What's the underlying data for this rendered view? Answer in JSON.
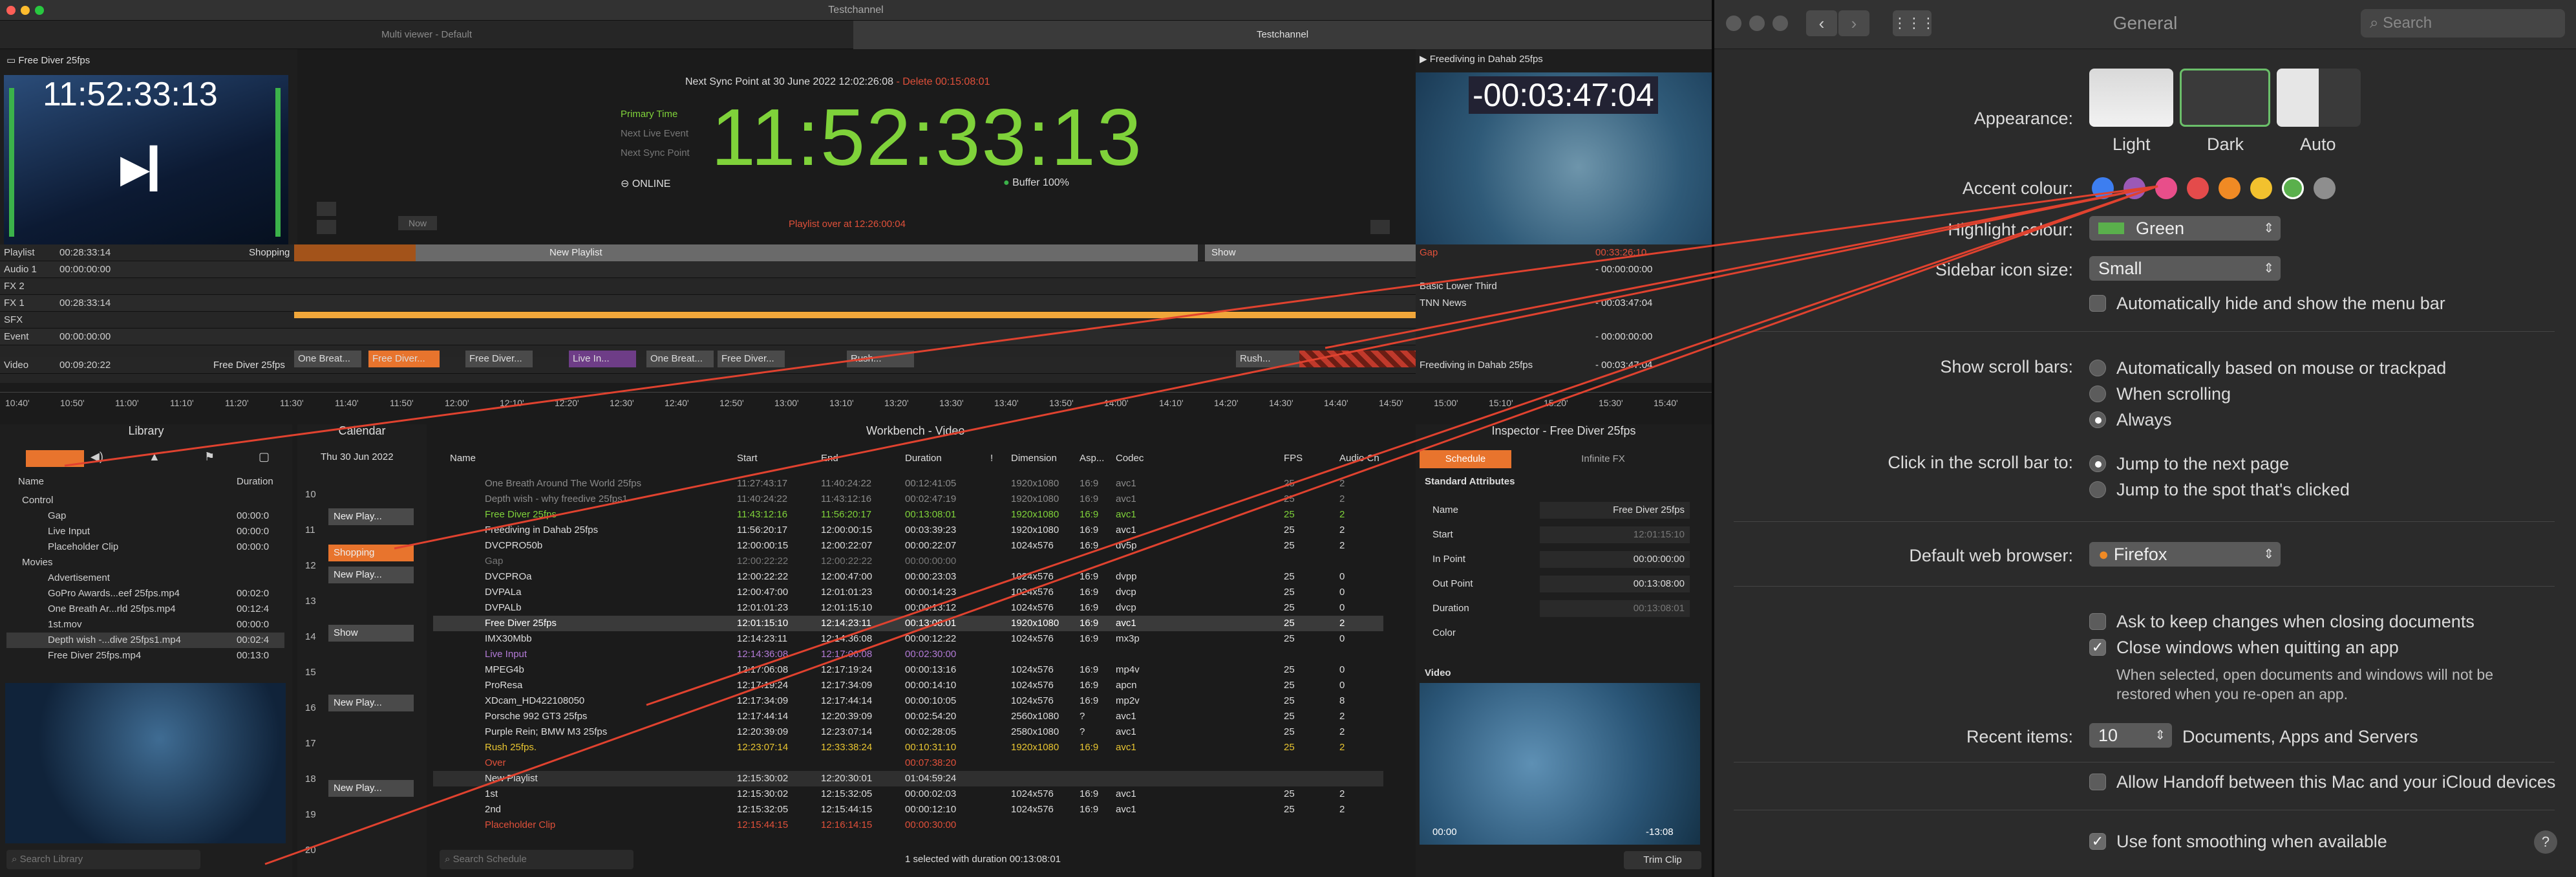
{
  "window": {
    "title": "Testchannel",
    "tabs": [
      "Multi viewer - Default",
      "Testchannel"
    ]
  },
  "preview_left": {
    "title": "Free Diver   25fps",
    "timecode": "11:52:33:13"
  },
  "clock": {
    "sync_line": "Next Sync Point at 30 June 2022 12:02:26:08",
    "sync_delta": "- Delete 00:15:08:01",
    "labels": [
      "Primary Time",
      "Next Live Event",
      "Next Sync Point"
    ],
    "time": "11:52:33:13",
    "status": "ONLINE",
    "buffer_label": "Buffer",
    "buffer_value": "100%",
    "now_button": "Now",
    "playlist_over": "Playlist over at 12:26:00:04"
  },
  "preview_right": {
    "title": "Freediving in Dahab 25fps",
    "timecode": "-00:03:47:04"
  },
  "timeline": {
    "rows": [
      {
        "label": "Playlist",
        "time": "00:28:33:14",
        "extra": "Shopping"
      },
      {
        "label": "Audio 1",
        "time": "00:00:00:00",
        "extra": ""
      },
      {
        "label": "FX 2",
        "time": "",
        "extra": ""
      },
      {
        "label": "FX 1",
        "time": "00:28:33:14",
        "extra": ""
      },
      {
        "label": "SFX",
        "time": "",
        "extra": ""
      },
      {
        "label": "Event",
        "time": "00:00:00:00",
        "extra": ""
      },
      {
        "label": "Video",
        "time": "00:09:20:22",
        "extra": "Free Diver  25fps"
      }
    ],
    "playlist_bars": [
      "New Playlist",
      "Show"
    ],
    "clips": [
      "One Breat...",
      "Free Diver...",
      "Free Diver...",
      "Live In...",
      "One Breat...",
      "Free Diver...",
      "Rush...",
      "Rush..."
    ],
    "right_rows": [
      {
        "label": "Gap",
        "time": "00:33:26:10"
      },
      {
        "label": "",
        "time": "- 00:00:00:00"
      },
      {
        "label": "Basic Lower Third",
        "time": ""
      },
      {
        "label": "TNN News",
        "time": "- 00:03:47:04"
      },
      {
        "label": "",
        "time": ""
      },
      {
        "label": "",
        "time": "- 00:00:00:00"
      },
      {
        "label": "Freediving in Dahab 25fps",
        "time": "- 00:03:47:04"
      }
    ],
    "ruler": [
      "10:40'",
      "10:50'",
      "11:00'",
      "11:10'",
      "11:20'",
      "11:30'",
      "11:40'",
      "11:50'",
      "12:00'",
      "12:10'",
      "12:20'",
      "12:30'",
      "12:40'",
      "12:50'",
      "13:00'",
      "13:10'",
      "13:20'",
      "13:30'",
      "13:40'",
      "13:50'",
      "14:00'",
      "14:10'",
      "14:20'",
      "14:30'",
      "14:40'",
      "14:50'",
      "15:00'",
      "15:10'",
      "15:20'",
      "15:30'",
      "15:40'"
    ]
  },
  "library": {
    "title": "Library",
    "col_name": "Name",
    "col_duration": "Duration",
    "items": [
      {
        "name": "Control",
        "duration": "",
        "indent": 0
      },
      {
        "name": "Gap",
        "duration": "00:00:0",
        "indent": 1
      },
      {
        "name": "Live Input",
        "duration": "00:00:0",
        "indent": 1
      },
      {
        "name": "Placeholder Clip",
        "duration": "00:00:0",
        "indent": 1
      },
      {
        "name": "Movies",
        "duration": "",
        "indent": 0
      },
      {
        "name": "Advertisement",
        "duration": "",
        "indent": 1
      },
      {
        "name": "GoPro Awards...eef 25fps.mp4",
        "duration": "00:02:0",
        "indent": 1
      },
      {
        "name": "One Breath Ar...rld 25fps.mp4",
        "duration": "00:12:4",
        "indent": 1
      },
      {
        "name": "1st.mov",
        "duration": "00:00:0",
        "indent": 1
      },
      {
        "name": "Depth wish -...dive 25fps1.mp4",
        "duration": "00:02:4",
        "indent": 1
      },
      {
        "name": "Free Diver  25fps.mp4",
        "duration": "00:13:0",
        "indent": 1
      }
    ],
    "search_placeholder": "Search Library"
  },
  "calendar": {
    "title": "Calendar",
    "date": "Thu 30 Jun 2022",
    "hours": [
      "10",
      "11",
      "12",
      "13",
      "14",
      "15",
      "16",
      "17",
      "18",
      "19",
      "20"
    ],
    "events": [
      "New Play...",
      "Shopping",
      "New Play...",
      "Show",
      "New Play...",
      "New Play..."
    ]
  },
  "workbench": {
    "title": "Workbench - Video",
    "columns": [
      "Name",
      "Start",
      "End",
      "Duration",
      "!",
      "Dimension",
      "Asp...",
      "Codec",
      "FPS",
      "Audio Ch"
    ],
    "rows": [
      {
        "name": "One Breath Around The World 25fps",
        "start": "11:27:43:17",
        "end": "11:40:24:22",
        "duration": "00:12:41:05",
        "dim": "1920x1080",
        "asp": "16:9",
        "codec": "avc1",
        "fps": "25",
        "audio": "2",
        "color": "#8a8a8a"
      },
      {
        "name": "Depth wish - why freedive 25fps1",
        "start": "11:40:24:22",
        "end": "11:43:12:16",
        "duration": "00:02:47:19",
        "dim": "1920x1080",
        "asp": "16:9",
        "codec": "avc1",
        "fps": "25",
        "audio": "2",
        "color": "#8a8a8a"
      },
      {
        "name": "Free Diver  25fps",
        "start": "11:43:12:16",
        "end": "11:56:20:17",
        "duration": "00:13:08:01",
        "dim": "1920x1080",
        "asp": "16:9",
        "codec": "avc1",
        "fps": "25",
        "audio": "2",
        "color": "#7fd23a"
      },
      {
        "name": "Freediving in Dahab 25fps",
        "start": "11:56:20:17",
        "end": "12:00:00:15",
        "duration": "00:03:39:23",
        "dim": "1920x1080",
        "asp": "16:9",
        "codec": "avc1",
        "fps": "25",
        "audio": "2",
        "color": "#dddddd"
      },
      {
        "name": "DVCPRO50b",
        "start": "12:00:00:15",
        "end": "12:00:22:07",
        "duration": "00:00:22:07",
        "dim": "1024x576",
        "asp": "16:9",
        "codec": "dv5p",
        "fps": "25",
        "audio": "2",
        "color": "#dddddd"
      },
      {
        "name": "Gap",
        "start": "12:00:22:22",
        "end": "12:00:22:22",
        "duration": "00:00:00:00",
        "dim": "",
        "asp": "",
        "codec": "",
        "fps": "",
        "audio": "",
        "color": "#777777"
      },
      {
        "name": "DVCPROa",
        "start": "12:00:22:22",
        "end": "12:00:47:00",
        "duration": "00:00:23:03",
        "dim": "1024x576",
        "asp": "16:9",
        "codec": "dvpp",
        "fps": "25",
        "audio": "0",
        "color": "#dddddd"
      },
      {
        "name": "DVPALa",
        "start": "12:00:47:00",
        "end": "12:01:01:23",
        "duration": "00:00:14:23",
        "dim": "1024x576",
        "asp": "16:9",
        "codec": "dvcp",
        "fps": "25",
        "audio": "0",
        "color": "#dddddd"
      },
      {
        "name": "DVPALb",
        "start": "12:01:01:23",
        "end": "12:01:15:10",
        "duration": "00:00:13:12",
        "dim": "1024x576",
        "asp": "16:9",
        "codec": "dvcp",
        "fps": "25",
        "audio": "0",
        "color": "#dddddd"
      },
      {
        "name": "Free Diver  25fps",
        "start": "12:01:15:10",
        "end": "12:14:23:11",
        "duration": "00:13:08:01",
        "dim": "1920x1080",
        "asp": "16:9",
        "codec": "avc1",
        "fps": "25",
        "audio": "2",
        "color": "#ffffff"
      },
      {
        "name": "IMX30Mbb",
        "start": "12:14:23:11",
        "end": "12:14:36:08",
        "duration": "00:00:12:22",
        "dim": "1024x576",
        "asp": "16:9",
        "codec": "mx3p",
        "fps": "25",
        "audio": "0",
        "color": "#dddddd"
      },
      {
        "name": "Live Input",
        "start": "12:14:36:08",
        "end": "12:17:06:08",
        "duration": "00:02:30:00",
        "dim": "",
        "asp": "",
        "codec": "",
        "fps": "",
        "audio": "",
        "color": "#b27ad6"
      },
      {
        "name": "MPEG4b",
        "start": "12:17:06:08",
        "end": "12:17:19:24",
        "duration": "00:00:13:16",
        "dim": "1024x576",
        "asp": "16:9",
        "codec": "mp4v",
        "fps": "25",
        "audio": "0",
        "color": "#dddddd"
      },
      {
        "name": "ProResa",
        "start": "12:17:19:24",
        "end": "12:17:34:09",
        "duration": "00:00:14:10",
        "dim": "1024x576",
        "asp": "16:9",
        "codec": "apcn",
        "fps": "25",
        "audio": "0",
        "color": "#dddddd"
      },
      {
        "name": "XDcam_HD422108050",
        "start": "12:17:34:09",
        "end": "12:17:44:14",
        "duration": "00:00:10:05",
        "dim": "1024x576",
        "asp": "16:9",
        "codec": "mp2v",
        "fps": "25",
        "audio": "8",
        "color": "#dddddd"
      },
      {
        "name": "Porsche 992 GT3 25fps",
        "start": "12:17:44:14",
        "end": "12:20:39:09",
        "duration": "00:02:54:20",
        "dim": "2560x1080",
        "asp": "?",
        "codec": "avc1",
        "fps": "25",
        "audio": "2",
        "color": "#dddddd"
      },
      {
        "name": "Purple Rein; BMW M3   25fps",
        "start": "12:20:39:09",
        "end": "12:23:07:14",
        "duration": "00:02:28:05",
        "dim": "2580x1080",
        "asp": "?",
        "codec": "avc1",
        "fps": "25",
        "audio": "2",
        "color": "#dddddd"
      },
      {
        "name": "Rush 25fps.",
        "start": "12:23:07:14",
        "end": "12:33:38:24",
        "duration": "00:10:31:10",
        "dim": "1920x1080",
        "asp": "16:9",
        "codec": "avc1",
        "fps": "25",
        "audio": "2",
        "color": "#e8c531"
      },
      {
        "name": "Over",
        "start": "",
        "end": "",
        "duration": "00:07:38:20",
        "dim": "",
        "asp": "",
        "codec": "",
        "fps": "",
        "audio": "",
        "color": "#e0503a"
      },
      {
        "name": "New Playlist",
        "start": "12:15:30:02",
        "end": "12:20:30:01",
        "duration": "01:04:59:24",
        "dim": "",
        "asp": "",
        "codec": "",
        "fps": "",
        "audio": "",
        "color": "#dddddd"
      },
      {
        "name": "1st",
        "start": "12:15:30:02",
        "end": "12:15:32:05",
        "duration": "00:00:02:03",
        "dim": "1024x576",
        "asp": "16:9",
        "codec": "avc1",
        "fps": "25",
        "audio": "2",
        "color": "#dddddd"
      },
      {
        "name": "2nd",
        "start": "12:15:32:05",
        "end": "12:15:44:15",
        "duration": "00:00:12:10",
        "dim": "1024x576",
        "asp": "16:9",
        "codec": "avc1",
        "fps": "25",
        "audio": "2",
        "color": "#dddddd"
      },
      {
        "name": "Placeholder Clip",
        "start": "12:15:44:15",
        "end": "12:16:14:15",
        "duration": "00:00:30:00",
        "dim": "",
        "asp": "",
        "codec": "",
        "fps": "",
        "audio": "",
        "color": "#e0503a"
      }
    ],
    "search_placeholder": "Search Schedule",
    "status": "1 selected with duration 00:13:08:01"
  },
  "inspector": {
    "title": "Inspector - Free Diver   25fps",
    "tabs": [
      "Schedule",
      "Infinite FX"
    ],
    "section": "Standard Attributes",
    "fields": [
      {
        "label": "Name",
        "value": "Free Diver   25fps"
      },
      {
        "label": "Start",
        "value": "12:01:15:10"
      },
      {
        "label": "In Point",
        "value": "00:00:00:00"
      },
      {
        "label": "Out Point",
        "value": "00:13:08:00"
      },
      {
        "label": "Duration",
        "value": "00:13:08:01"
      },
      {
        "label": "Color",
        "value": ""
      }
    ],
    "video_section": "Video",
    "video_time_start": "00:00",
    "video_time_end": "-13:08",
    "trim_button": "Trim Clip"
  },
  "prefs": {
    "title": "General",
    "search_placeholder": "Search",
    "appearance_label": "Appearance:",
    "appearance_options": [
      "Light",
      "Dark",
      "Auto"
    ],
    "accent_label": "Accent colour:",
    "accent_colors": [
      "#3d7ef0",
      "#9b59b6",
      "#e84e8a",
      "#e44b4b",
      "#f08a24",
      "#f2c12e",
      "#5ab04c",
      "#8e8e8e"
    ],
    "highlight_label": "Highlight colour:",
    "highlight_value": "Green",
    "sidebar_label": "Sidebar icon size:",
    "sidebar_value": "Small",
    "autohide_menu": "Automatically hide and show the menu bar",
    "scroll_label": "Show scroll bars:",
    "scroll_options": [
      "Automatically based on mouse or trackpad",
      "When scrolling",
      "Always"
    ],
    "click_label": "Click in the scroll bar to:",
    "click_options": [
      "Jump to the next page",
      "Jump to the spot that's clicked"
    ],
    "browser_label": "Default web browser:",
    "browser_value": "Firefox",
    "ask_keep": "Ask to keep changes when closing documents",
    "close_windows": "Close windows when quitting an app",
    "close_note": "When selected, open documents and windows will not be restored when you re-open an app.",
    "recent_label": "Recent items:",
    "recent_value": "10",
    "recent_suffix": "Documents, Apps and Servers",
    "handoff": "Allow Handoff between this Mac and your iCloud devices",
    "font_smoothing": "Use font smoothing when available",
    "help": "?"
  }
}
